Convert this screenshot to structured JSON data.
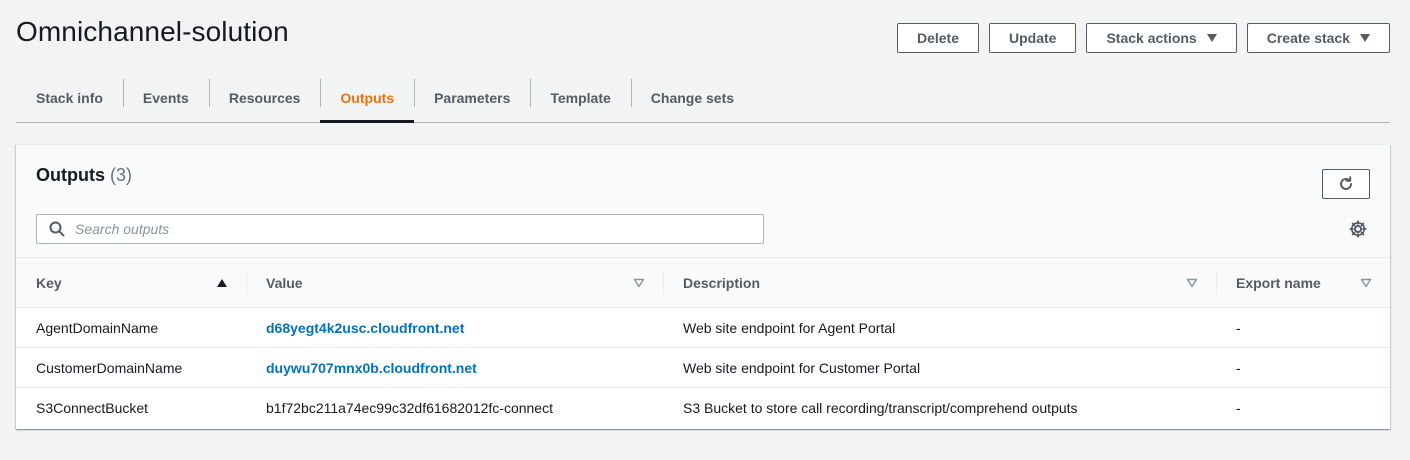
{
  "page": {
    "title": "Omnichannel-solution"
  },
  "actions": {
    "delete": "Delete",
    "update": "Update",
    "stack_actions": "Stack actions",
    "create_stack": "Create stack"
  },
  "tabs": [
    {
      "label": "Stack info"
    },
    {
      "label": "Events"
    },
    {
      "label": "Resources"
    },
    {
      "label": "Outputs",
      "active": true
    },
    {
      "label": "Parameters"
    },
    {
      "label": "Template"
    },
    {
      "label": "Change sets"
    }
  ],
  "outputs": {
    "title": "Outputs",
    "count": "(3)",
    "search_placeholder": "Search outputs",
    "columns": [
      "Key",
      "Value",
      "Description",
      "Export name"
    ],
    "rows": [
      {
        "key": "AgentDomainName",
        "value": "d68yegt4k2usc.cloudfront.net",
        "value_is_link": true,
        "description": "Web site endpoint for Agent Portal",
        "export": "-"
      },
      {
        "key": "CustomerDomainName",
        "value": "duywu707mnx0b.cloudfront.net",
        "value_is_link": true,
        "description": "Web site endpoint for Customer Portal",
        "export": "-"
      },
      {
        "key": "S3ConnectBucket",
        "value": "b1f72bc211a74ec99c32df61682012fc-connect",
        "value_is_link": false,
        "description": "S3 Bucket to store call recording/transcript/comprehend outputs",
        "export": "-"
      }
    ]
  },
  "icons": {
    "refresh": "refresh-icon",
    "search": "search-icon",
    "settings": "gear-icon",
    "sort_asc": "sort-ascending-icon",
    "sort_none": "sort-descending-outline-icon",
    "caret": "caret-down-icon"
  },
  "colors": {
    "accent_tab": "#ec7211",
    "link": "#0073bb",
    "background": "#f2f3f3"
  }
}
